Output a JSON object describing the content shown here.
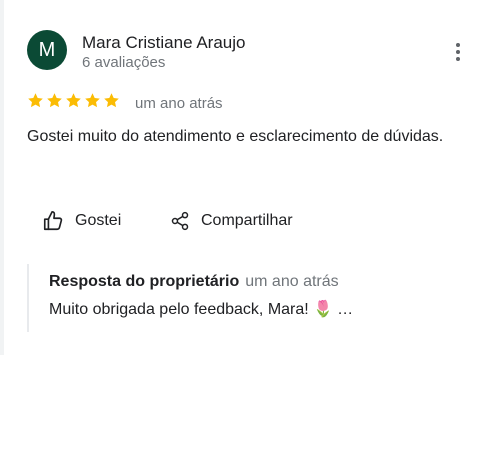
{
  "review": {
    "avatar_letter": "M",
    "avatar_color": "#0b4a35",
    "author_name": "Mara Cristiane Araujo",
    "review_count": "6 avaliações",
    "rating": 5,
    "max_rating": 5,
    "star_color": "#fbbc04",
    "time_ago": "um ano atrás",
    "text": "Gostei muito do atendimento e esclarecimento de dúvidas.",
    "more_icon": "more-vertical-icon"
  },
  "actions": {
    "like_label": "Gostei",
    "like_icon": "thumbs-up-icon",
    "share_label": "Compartilhar",
    "share_icon": "share-icon"
  },
  "owner_reply": {
    "title": "Resposta do proprietário",
    "time_ago": "um ano atrás",
    "text": "Muito obrigada pelo feedback, Mara! 🌷",
    "ellipsis": "…"
  }
}
